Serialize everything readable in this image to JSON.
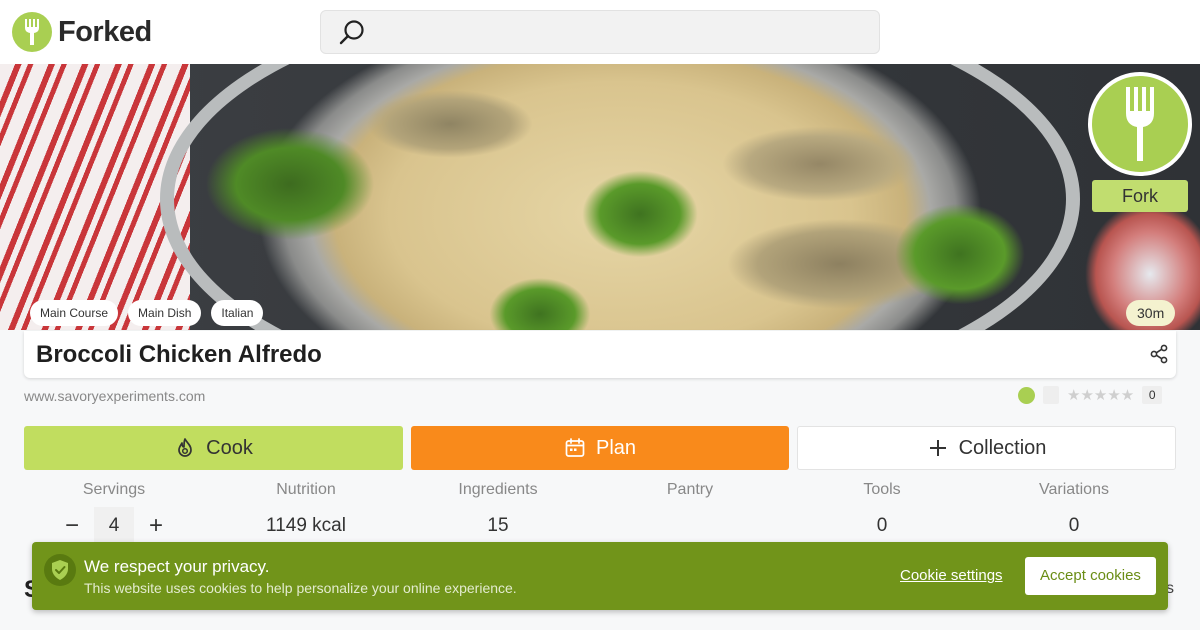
{
  "header": {
    "logo_text": "Forked",
    "search": {
      "placeholder": "",
      "value": ""
    }
  },
  "hero": {
    "image_alt": "Broccoli Chicken Alfredo",
    "tags": [
      "Main Course",
      "Main Dish",
      "Italian"
    ],
    "time": "30m",
    "fork_label": "Fork"
  },
  "recipe": {
    "title": "Broccoli Chicken Alfredo",
    "source": "www.savoryexperiments.com",
    "rating_count": "0"
  },
  "actions": {
    "cook": "Cook",
    "plan": "Plan",
    "collection": "Collection"
  },
  "stats": {
    "servings": {
      "label": "Servings",
      "value": "4",
      "minus": "−",
      "plus": "+"
    },
    "nutrition": {
      "label": "Nutrition",
      "value": "1149 kcal"
    },
    "ingredients": {
      "label": "Ingredients",
      "value": "15"
    },
    "pantry": {
      "label": "Pantry",
      "value": ""
    },
    "tools": {
      "label": "Tools",
      "value": "0"
    },
    "variations": {
      "label": "Variations",
      "value": "0"
    }
  },
  "below_fold": {
    "left_letter": "S",
    "right_letter": "s"
  },
  "cookie_banner": {
    "title": "We respect your privacy.",
    "text": "This website uses cookies to help personalize your online experience.",
    "settings": "Cookie settings",
    "accept": "Accept cookies"
  },
  "colors": {
    "brand_green": "#a9cf52",
    "cook_button": "#c1dd5f",
    "plan_button": "#f98a1b",
    "cookie_banner": "#71941a"
  },
  "icons": {
    "logo": "fork-icon",
    "search": "search-icon",
    "share": "share-icon",
    "cook": "flame-icon",
    "plan": "calendar-icon",
    "collection": "plus-icon",
    "privacy": "shield-check-icon"
  }
}
